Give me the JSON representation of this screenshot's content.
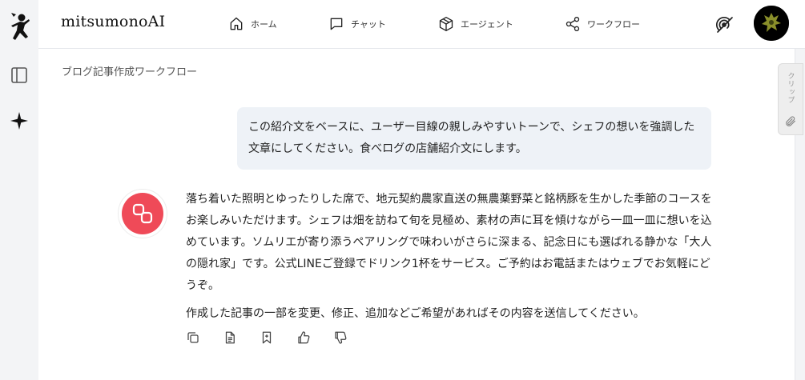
{
  "app": {
    "brand": "mitsumonoAI"
  },
  "rail": {
    "items": [
      {
        "icon": "ninja-logo-icon"
      },
      {
        "icon": "sidebar-toggle-icon"
      },
      {
        "icon": "sparkle-icon"
      }
    ]
  },
  "nav": {
    "items": [
      {
        "label": "ホーム",
        "icon": "home-icon"
      },
      {
        "label": "チャット",
        "icon": "chat-icon"
      },
      {
        "label": "エージェント",
        "icon": "cube-icon"
      },
      {
        "label": "ワークフロー",
        "icon": "share-icon"
      }
    ],
    "right_icon": "broadcast-icon"
  },
  "clip_tab": {
    "label": "クリップ",
    "icon": "paperclip-icon"
  },
  "breadcrumb": "ブログ記事作成ワークフロー",
  "messages": {
    "user": "この紹介文をベースに、ユーザー目線の親しみやすいトーンで、シェフの想いを強調した文章にしてください。食べログの店舗紹介文にします。",
    "ai": "落ち着いた照明とゆったりした席で、地元契約農家直送の無農薬野菜と銘柄豚を生かした季節のコースをお楽しみいただけます。シェフは畑を訪ねて旬を見極め、素材の声に耳を傾けながら一皿一皿に想いを込めています。ソムリエが寄り添うペアリングで味わいがさらに深まる、記念日にも選ばれる静かな「大人の隠れ家」です。公式LINEご登録でドリンク1杯をサービス。ご予約はお電話またはウェブでお気軽にどうぞ。",
    "ai_followup": "作成した記事の一部を変更、修正、追加などご希望があればその内容を送信してください。"
  },
  "actions": [
    "copy-icon",
    "document-icon",
    "bookmark-icon",
    "thumbs-up-icon",
    "thumbs-down-icon"
  ],
  "colors": {
    "ai_avatar": "#ef4a58",
    "user_bubble": "#eef2f7",
    "rail": "#f3f4f6"
  }
}
